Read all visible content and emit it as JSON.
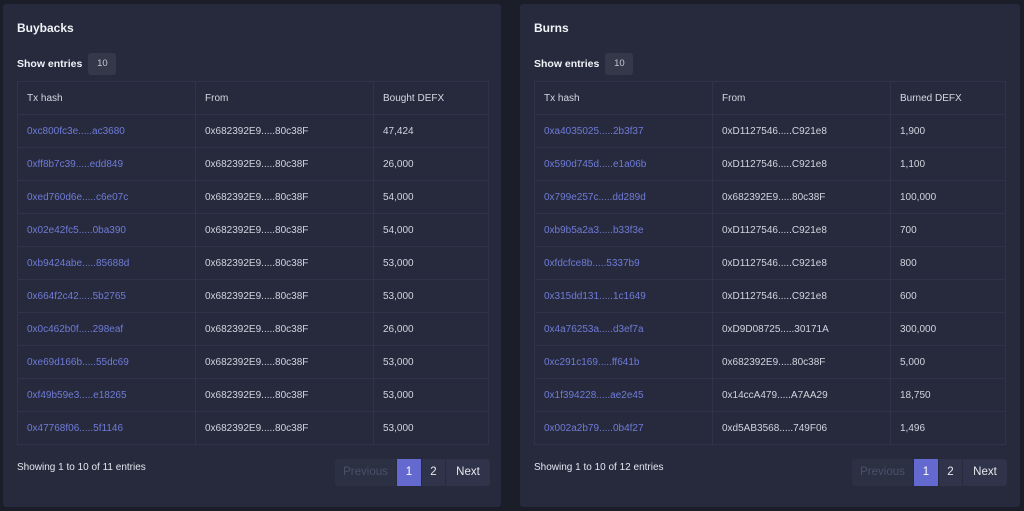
{
  "buybacks": {
    "title": "Buybacks",
    "show_entries_label": "Show entries",
    "entries_value": "10",
    "columns": [
      "Tx hash",
      "From",
      "Bought DEFX"
    ],
    "rows": [
      [
        "0xc800fc3e.....ac3680",
        "0x682392E9.....80c38F",
        "47,424"
      ],
      [
        "0xff8b7c39.....edd849",
        "0x682392E9.....80c38F",
        "26,000"
      ],
      [
        "0xed760d6e.....c6e07c",
        "0x682392E9.....80c38F",
        "54,000"
      ],
      [
        "0x02e42fc5.....0ba390",
        "0x682392E9.....80c38F",
        "54,000"
      ],
      [
        "0xb9424abe.....85688d",
        "0x682392E9.....80c38F",
        "53,000"
      ],
      [
        "0x664f2c42.....5b2765",
        "0x682392E9.....80c38F",
        "53,000"
      ],
      [
        "0x0c462b0f.....298eaf",
        "0x682392E9.....80c38F",
        "26,000"
      ],
      [
        "0xe69d166b.....55dc69",
        "0x682392E9.....80c38F",
        "53,000"
      ],
      [
        "0xf49b59e3.....e18265",
        "0x682392E9.....80c38F",
        "53,000"
      ],
      [
        "0x47768f06.....5f1146",
        "0x682392E9.....80c38F",
        "53,000"
      ]
    ],
    "showing_text": "Showing 1 to 10 of 11 entries",
    "pagination": {
      "previous": "Previous",
      "pages": [
        "1",
        "2"
      ],
      "next": "Next"
    }
  },
  "burns": {
    "title": "Burns",
    "show_entries_label": "Show entries",
    "entries_value": "10",
    "columns": [
      "Tx hash",
      "From",
      "Burned DEFX"
    ],
    "rows": [
      [
        "0xa4035025.....2b3f37",
        "0xD1127546.....C921e8",
        "1,900"
      ],
      [
        "0x590d745d.....e1a06b",
        "0xD1127546.....C921e8",
        "1,100"
      ],
      [
        "0x799e257c.....dd289d",
        "0x682392E9.....80c38F",
        "100,000"
      ],
      [
        "0xb9b5a2a3.....b33f3e",
        "0xD1127546.....C921e8",
        "700"
      ],
      [
        "0xfdcfce8b.....5337b9",
        "0xD1127546.....C921e8",
        "800"
      ],
      [
        "0x315dd131.....1c1649",
        "0xD1127546.....C921e8",
        "600"
      ],
      [
        "0x4a76253a.....d3ef7a",
        "0xD9D08725.....30171A",
        "300,000"
      ],
      [
        "0xc291c169.....ff641b",
        "0x682392E9.....80c38F",
        "5,000"
      ],
      [
        "0x1f394228.....ae2e45",
        "0x14ccA479.....A7AA29",
        "18,750"
      ],
      [
        "0x002a2b79.....0b4f27",
        "0xd5AB3568.....749F06",
        "1,496"
      ]
    ],
    "showing_text": "Showing 1 to 10 of 12 entries",
    "pagination": {
      "previous": "Previous",
      "pages": [
        "1",
        "2"
      ],
      "next": "Next"
    }
  },
  "colors": {
    "accent": "#6469d0",
    "link": "#6f7bd8",
    "panel": "#262a3c",
    "background": "#1b1d29"
  }
}
